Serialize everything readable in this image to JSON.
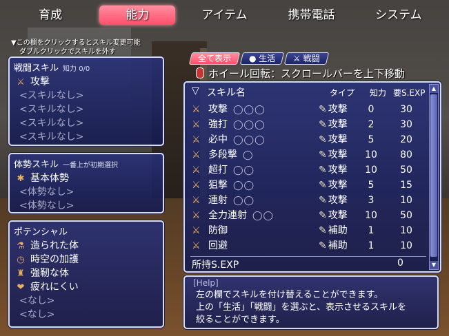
{
  "tabs": [
    "育成",
    "能力",
    "アイテム",
    "携帯電話",
    "システム"
  ],
  "hint": [
    "▼この欄をクリックするとスキル変更可能",
    "ダブルクリックでスキルを外す"
  ],
  "battle_skills": {
    "title": "戦闘スキル",
    "sub": "知力 0/0",
    "items": [
      {
        "icon": "sword-icon",
        "label": "攻撃",
        "dim": false
      },
      {
        "icon": "",
        "label": "<スキルなし>",
        "dim": true
      },
      {
        "icon": "",
        "label": "<スキルなし>",
        "dim": true
      },
      {
        "icon": "",
        "label": "<スキルなし>",
        "dim": true
      },
      {
        "icon": "",
        "label": "<スキルなし>",
        "dim": true
      }
    ]
  },
  "stance_skills": {
    "title": "体勢スキル",
    "sub": "一番上が初期選択",
    "items": [
      {
        "icon": "stance-icon",
        "label": "基本体勢",
        "dim": false
      },
      {
        "icon": "",
        "label": "<体勢なし>",
        "dim": true
      },
      {
        "icon": "",
        "label": "<体勢なし>",
        "dim": true
      }
    ]
  },
  "potential": {
    "title": "ポテンシャル",
    "items": [
      {
        "icon": "flask-icon",
        "label": "造られた体",
        "dim": false
      },
      {
        "icon": "clock-icon",
        "label": "時空の加護",
        "dim": false
      },
      {
        "icon": "fighter-icon",
        "label": "強靭な体",
        "dim": false
      },
      {
        "icon": "heart-icon",
        "label": "疲れにくい",
        "dim": false
      },
      {
        "icon": "",
        "label": "<なし>",
        "dim": true
      },
      {
        "icon": "",
        "label": "<なし>",
        "dim": true
      }
    ]
  },
  "filters": [
    {
      "label": "全て表示",
      "active": true
    },
    {
      "label": "生活",
      "active": false
    },
    {
      "label": "戦闘",
      "active": false
    }
  ],
  "wheel_hint": "ホイール回転：スクロールバーを上下移動",
  "table": {
    "headers": {
      "name": "スキル名",
      "type": "タイプ",
      "int": "知力",
      "exp": "要S.EXP"
    },
    "rows": [
      {
        "name": "攻撃",
        "slots": "◯◯◯",
        "type": "攻撃",
        "int": "0",
        "exp": "30"
      },
      {
        "name": "強打",
        "slots": "◯◯◯",
        "type": "攻撃",
        "int": "2",
        "exp": "30"
      },
      {
        "name": "必中",
        "slots": "◯◯◯",
        "type": "攻撃",
        "int": "5",
        "exp": "20"
      },
      {
        "name": "多段撃",
        "slots": "◯",
        "type": "攻撃",
        "int": "10",
        "exp": "80"
      },
      {
        "name": "超打",
        "slots": "◯◯",
        "type": "攻撃",
        "int": "10",
        "exp": "50"
      },
      {
        "name": "狙撃",
        "slots": "◯◯",
        "type": "攻撃",
        "int": "5",
        "exp": "15"
      },
      {
        "name": "連射",
        "slots": "◯◯",
        "type": "攻撃",
        "int": "3",
        "exp": "10"
      },
      {
        "name": "全力連射",
        "slots": "◯◯",
        "type": "攻撃",
        "int": "10",
        "exp": "50"
      },
      {
        "name": "防御",
        "slots": "",
        "type": "補助",
        "int": "1",
        "exp": "10"
      },
      {
        "name": "回避",
        "slots": "",
        "type": "補助",
        "int": "1",
        "exp": "10"
      }
    ],
    "owned_label": "所持S.EXP",
    "owned_value": "0"
  },
  "help": {
    "label": "[Help]",
    "lines": [
      "左の欄でスキルを付け替えることができます。",
      "上の「生活」「戦闘」を選ぶと、表示させるスキルを",
      "絞ることができます。"
    ]
  }
}
